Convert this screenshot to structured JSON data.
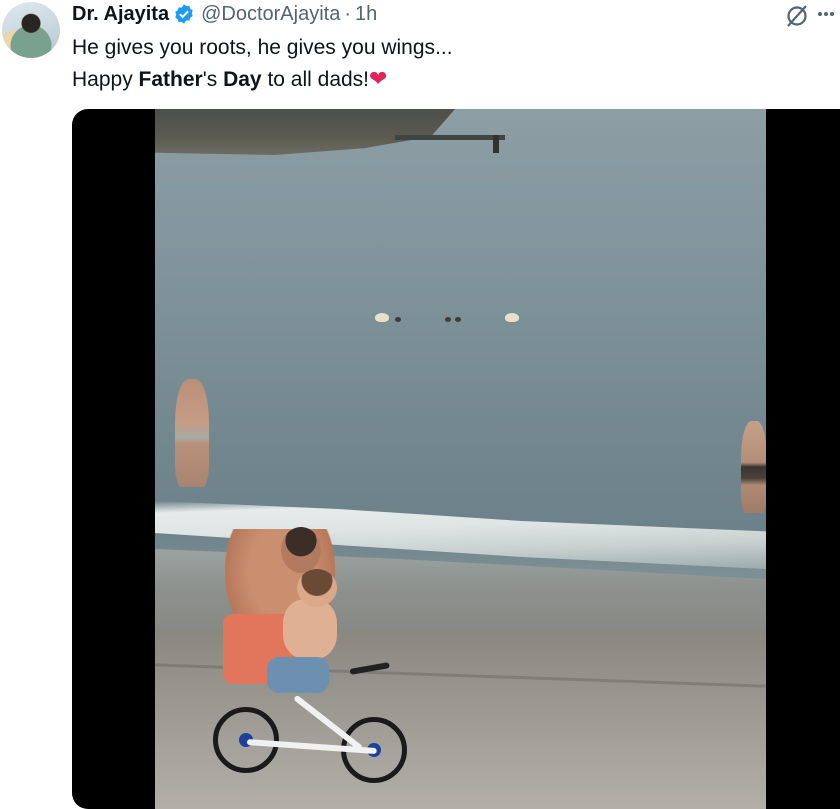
{
  "tweet": {
    "author_name": "Dr. Ajayita",
    "handle": "@DoctorAjayita",
    "separator": "·",
    "time": "1h",
    "verified_color": "#1d9bf0",
    "text_line1": "He gives you roots, he gives you wings...",
    "text_line2_before": "Happy ",
    "text_bold1": "Father",
    "text_line2_mid": "'s ",
    "text_bold2": "Day",
    "text_line2_after": " to all dads!",
    "heart_emoji": "❤"
  },
  "icons": {
    "verified": "verified-badge-icon",
    "grok": "grok-icon",
    "more": "more-options-icon"
  },
  "media": {
    "type": "video",
    "scene": "beach"
  }
}
